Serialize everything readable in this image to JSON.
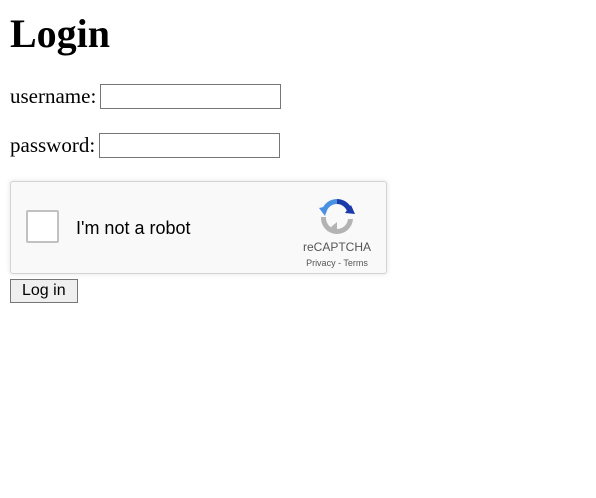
{
  "page": {
    "title": "Login"
  },
  "form": {
    "username_label": "username:",
    "username_value": "",
    "password_label": "password:",
    "password_value": "",
    "submit_label": "Log in"
  },
  "recaptcha": {
    "checkbox_label": "I'm not a robot",
    "checked": false,
    "brand": "reCAPTCHA",
    "privacy_label": "Privacy",
    "separator": " - ",
    "terms_label": "Terms",
    "logo_icon": "recaptcha-logo-icon"
  },
  "colors": {
    "recaptcha_background": "#f9f9f9",
    "recaptcha_border": "#d3d3d3",
    "button_background": "#efefef",
    "logo_blue": "#4a90e2",
    "logo_dark_blue": "#1c3aa9",
    "logo_gray": "#b3b3b3"
  }
}
